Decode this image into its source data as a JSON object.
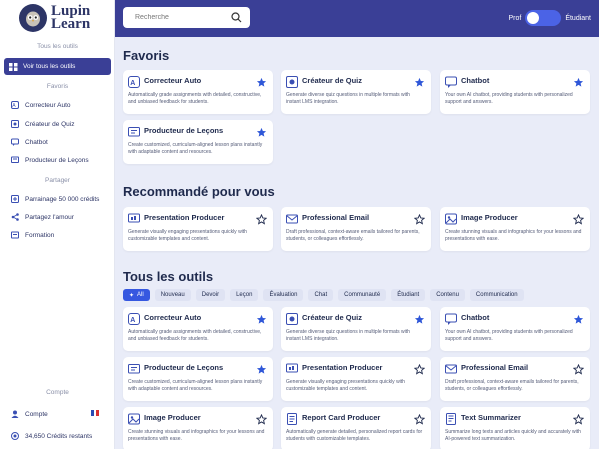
{
  "app": {
    "logo_line1": "Lupin",
    "logo_line2": "Learn"
  },
  "sidebar": {
    "section_all": "Tous les outils",
    "all_tools_button": "Voir tous les outils",
    "section_favorites": "Favoris",
    "favorites": [
      "Correcteur Auto",
      "Créateur de Quiz",
      "Chatbot",
      "Producteur de Leçons"
    ],
    "section_share": "Partager",
    "share_items": [
      "Parrainage 50 000 crédits",
      "Partagez l'amour",
      "Formation"
    ],
    "section_account": "Compte",
    "account_label": "Compte",
    "credits_label": "34,650 Crédits restants"
  },
  "header": {
    "search_placeholder": "Recherche",
    "toggle_left": "Prof",
    "toggle_right": "Étudiant"
  },
  "sections": {
    "favorites": "Favoris",
    "recommended": "Recommandé pour vous",
    "all_tools": "Tous les outils"
  },
  "favorite_cards": [
    {
      "title": "Correcteur Auto",
      "desc": "Automatically grade assignments with detailed, constructive, and unbiased feedback for students.",
      "starred": true,
      "icon": "auto-grade-icon"
    },
    {
      "title": "Créateur de Quiz",
      "desc": "Generate diverse quiz questions in multiple formats with instant LMS integration.",
      "starred": true,
      "icon": "quiz-icon"
    },
    {
      "title": "Chatbot",
      "desc": "Your own AI chatbot, providing students with personalized support and answers.",
      "starred": true,
      "icon": "chatbot-icon"
    },
    {
      "title": "Producteur de Leçons",
      "desc": "Create customized, curriculum-aligned lesson plans instantly with adaptable content and resources.",
      "starred": true,
      "icon": "lesson-icon"
    }
  ],
  "recommended_cards": [
    {
      "title": "Presentation Producer",
      "desc": "Generate visually engaging presentations quickly with customizable templates and content.",
      "starred": false,
      "icon": "presentation-icon"
    },
    {
      "title": "Professional Email",
      "desc": "Draft professional, context-aware emails tailored for parents, students, or colleagues effortlessly.",
      "starred": false,
      "icon": "email-icon"
    },
    {
      "title": "Image Producer",
      "desc": "Create stunning visuals and infographics for your lessons and presentations with ease.",
      "starred": false,
      "icon": "image-icon"
    }
  ],
  "filters": [
    "All",
    "Nouveau",
    "Devoir",
    "Leçon",
    "Évaluation",
    "Chat",
    "Communauté",
    "Étudiant",
    "Contenu",
    "Communication"
  ],
  "all_cards": [
    {
      "title": "Correcteur Auto",
      "desc": "Automatically grade assignments with detailed, constructive, and unbiased feedback for students.",
      "starred": true,
      "icon": "auto-grade-icon"
    },
    {
      "title": "Créateur de Quiz",
      "desc": "Generate diverse quiz questions in multiple formats with instant LMS integration.",
      "starred": true,
      "icon": "quiz-icon"
    },
    {
      "title": "Chatbot",
      "desc": "Your own AI chatbot, providing students with personalized support and answers.",
      "starred": true,
      "icon": "chatbot-icon"
    },
    {
      "title": "Producteur de Leçons",
      "desc": "Create customized, curriculum-aligned lesson plans instantly with adaptable content and resources.",
      "starred": true,
      "icon": "lesson-icon"
    },
    {
      "title": "Presentation Producer",
      "desc": "Generate visually engaging presentations quickly with customizable templates and content.",
      "starred": false,
      "icon": "presentation-icon"
    },
    {
      "title": "Professional Email",
      "desc": "Draft professional, context-aware emails tailored for parents, students, or colleagues effortlessly.",
      "starred": false,
      "icon": "email-icon"
    },
    {
      "title": "Image Producer",
      "desc": "Create stunning visuals and infographics for your lessons and presentations with ease.",
      "starred": false,
      "icon": "image-icon"
    },
    {
      "title": "Report Card Producer",
      "desc": "Automatically generate detailed, personalized report cards for students with customizable templates.",
      "starred": false,
      "icon": "report-card-icon"
    },
    {
      "title": "Text Summarizer",
      "desc": "Summarize long texts and articles quickly and accurately with AI-powered text summarization.",
      "starred": false,
      "icon": "summarizer-icon"
    }
  ],
  "colors": {
    "primary": "#3a3f96",
    "accent": "#3658e0",
    "background": "#e9ecf8"
  }
}
